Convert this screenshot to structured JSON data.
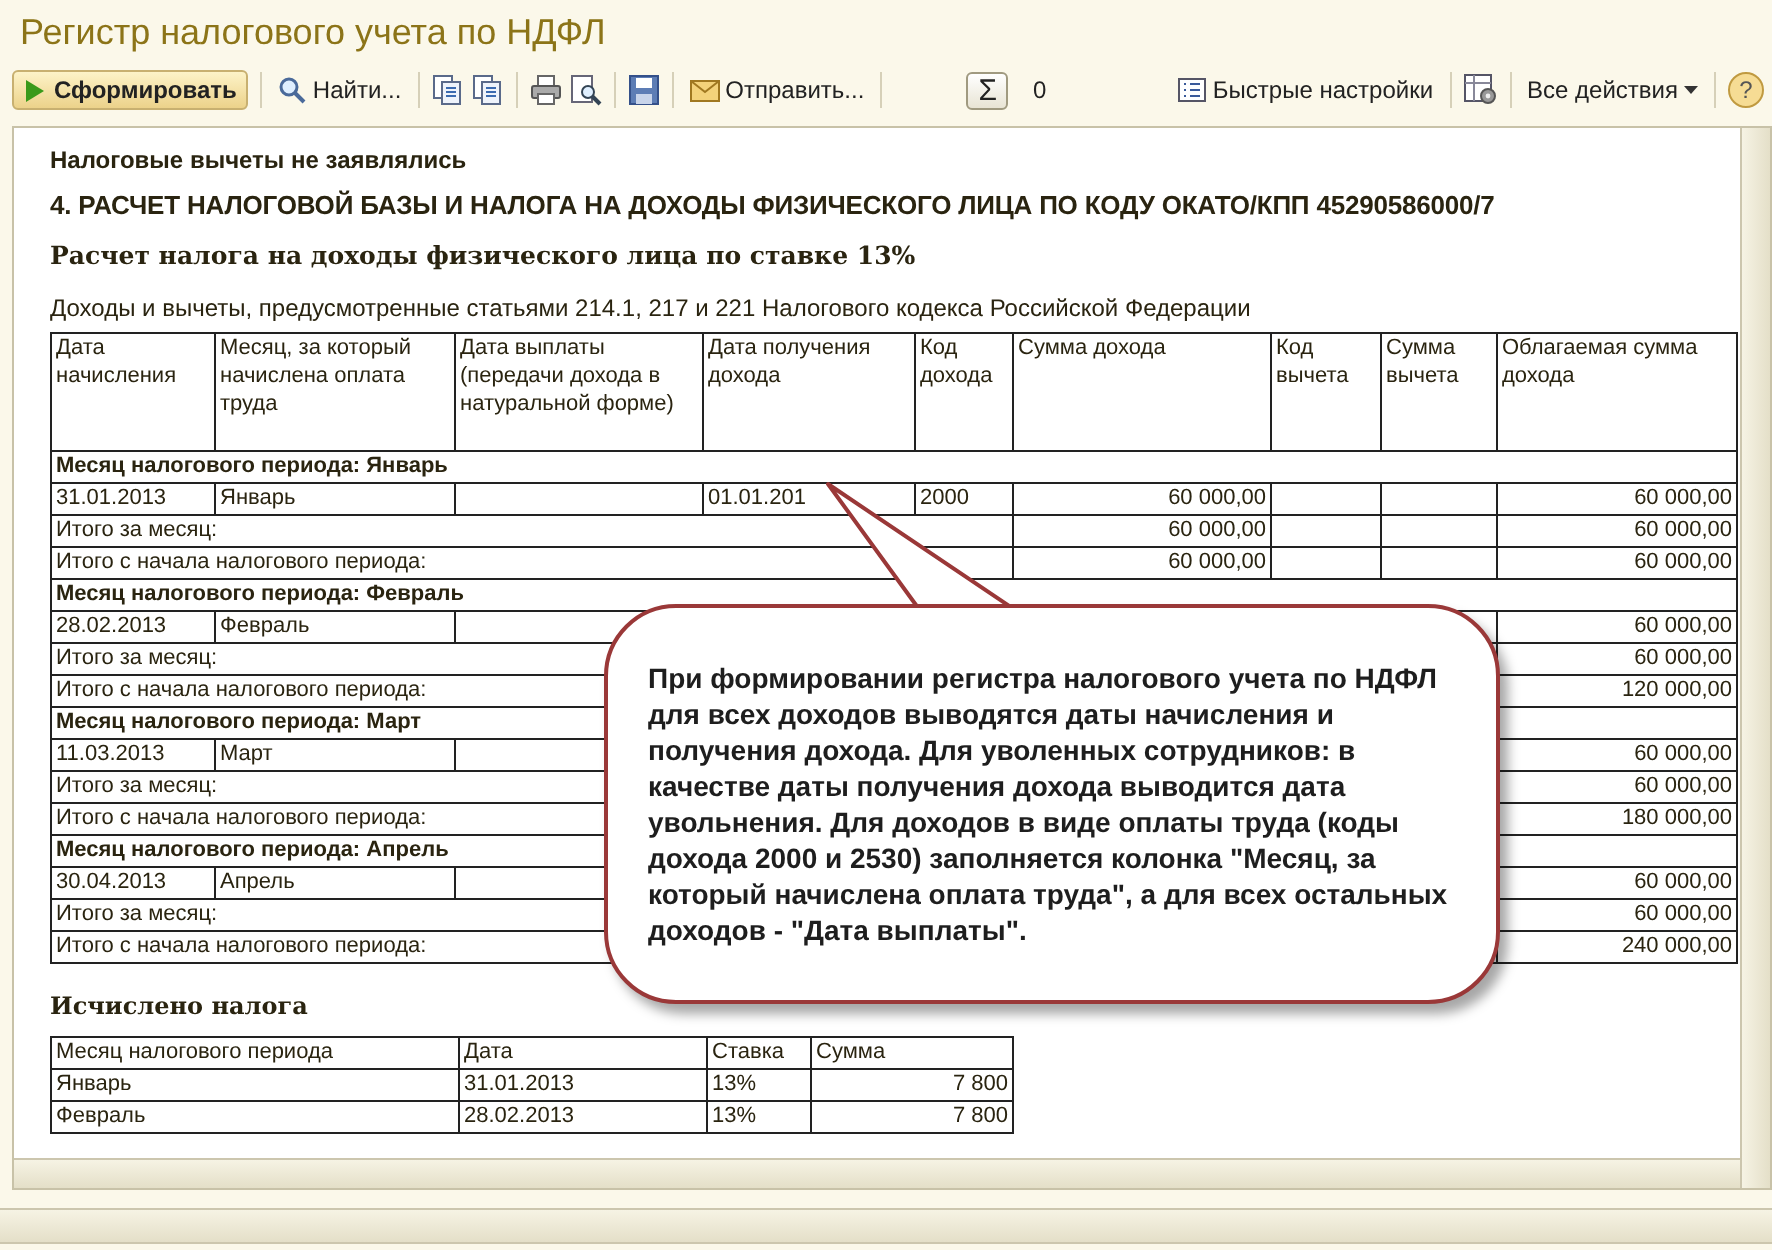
{
  "window": {
    "title": "Регистр налогового учета по НДФЛ"
  },
  "toolbar": {
    "left_groups": [
      [
        {
          "kind": "run",
          "label": "Сформировать"
        }
      ],
      [
        {
          "kind": "find",
          "label": "Найти..."
        }
      ],
      [
        {
          "kind": "copy"
        },
        {
          "kind": "copy"
        }
      ],
      [
        {
          "kind": "print"
        },
        {
          "kind": "preview"
        }
      ],
      [
        {
          "kind": "save"
        }
      ],
      [
        {
          "kind": "send",
          "label": "Отправить..."
        }
      ],
      [
        {
          "kind": "sum",
          "label": "Σ"
        },
        {
          "kind": "counter",
          "label": "0"
        }
      ]
    ],
    "right_groups": [
      [
        {
          "kind": "quick-settings",
          "label": "Быстрые настройки"
        }
      ],
      [
        {
          "kind": "table-settings"
        }
      ],
      [
        {
          "kind": "menu",
          "label": "Все действия"
        }
      ],
      [
        {
          "kind": "help",
          "label": "?"
        }
      ]
    ]
  },
  "report": {
    "note": "Налоговые вычеты не заявлялись",
    "heading": "4. РАСЧЕТ НАЛОГОВОЙ БАЗЫ И НАЛОГА НА ДОХОДЫ ФИЗИЧЕСКОГО ЛИЦА ПО КОДУ ОКАТО/КПП 45290586000/7",
    "subheading": "Расчет налога на доходы физического лица по ставке 13%",
    "caption": "Доходы и вычеты, предусмотренные статьями 214.1, 217 и 221 Налогового кодекса Российской Федерации",
    "income_table": {
      "columns": [
        "Дата начисления",
        "Месяц, за который начислена оплата труда",
        "Дата выплаты (передачи дохода в натуральной форме)",
        "Дата получения дохода",
        "Код дохода",
        "Сумма дохода",
        "Код вычета",
        "Сумма вычета",
        "Облагаемая сумма дохода"
      ],
      "groups": [
        {
          "title": "Месяц налогового периода: Январь",
          "rows": [
            {
              "kind": "entry",
              "accrual_date": "31.01.2013",
              "month": "Январь",
              "receipt_date": "01.01.201",
              "income_code": "2000",
              "income_sum": "60 000,00",
              "taxable_sum": "60 000,00"
            },
            {
              "kind": "total",
              "label": "Итого за месяц:",
              "income_sum": "60 000,00",
              "taxable_sum": "60 000,00"
            },
            {
              "kind": "total",
              "label": "Итого с начала налогового периода:",
              "income_sum": "60 000,00",
              "taxable_sum": "60 000,00"
            }
          ]
        },
        {
          "title": "Месяц налогового периода: Февраль",
          "rows": [
            {
              "kind": "entry",
              "accrual_date": "28.02.2013",
              "month": "Февраль",
              "taxable_sum": "60 000,00"
            },
            {
              "kind": "total",
              "label": "Итого за месяц:",
              "taxable_sum": "60 000,00"
            },
            {
              "kind": "total",
              "label": "Итого с начала налогового периода:",
              "taxable_sum": "120 000,00"
            }
          ]
        },
        {
          "title": "Месяц налогового периода: Март",
          "rows": [
            {
              "kind": "entry",
              "accrual_date": "11.03.2013",
              "month": "Март",
              "taxable_sum": "60 000,00"
            },
            {
              "kind": "total",
              "label": "Итого за месяц:",
              "taxable_sum": "60 000,00"
            },
            {
              "kind": "total",
              "label": "Итого с начала налогового периода:",
              "taxable_sum": "180 000,00"
            }
          ]
        },
        {
          "title": "Месяц налогового периода: Апрель",
          "rows": [
            {
              "kind": "entry",
              "accrual_date": "30.04.2013",
              "month": "Апрель",
              "taxable_sum": "60 000,00"
            },
            {
              "kind": "total",
              "label": "Итого за месяц:",
              "taxable_sum": "60 000,00"
            },
            {
              "kind": "total",
              "label": "Итого с начала налогового периода:",
              "taxable_sum": "240 000,00"
            }
          ]
        }
      ]
    },
    "tax_title": "Исчислено налога",
    "tax_table": {
      "columns": [
        "Месяц налогового периода",
        "Дата",
        "Ставка",
        "Сумма"
      ],
      "rows": [
        {
          "month": "Январь",
          "date": "31.01.2013",
          "rate": "13%",
          "amount": "7 800"
        },
        {
          "month": "Февраль",
          "date": "28.02.2013",
          "rate": "13%",
          "amount": "7 800"
        }
      ]
    }
  },
  "callout": {
    "text": "При формировании регистра налогового учета по НДФЛ для всех доходов выводятся даты начисления и получения дохода. Для уволенных сотрудников: в качестве даты получения дохода выводится дата увольнения. Для доходов в виде оплаты труда (коды дохода 2000 и 2530) заполняется колонка \"Месяц, за который начислена оплата труда\", а для всех остальных доходов - \"Дата выплаты\"."
  }
}
